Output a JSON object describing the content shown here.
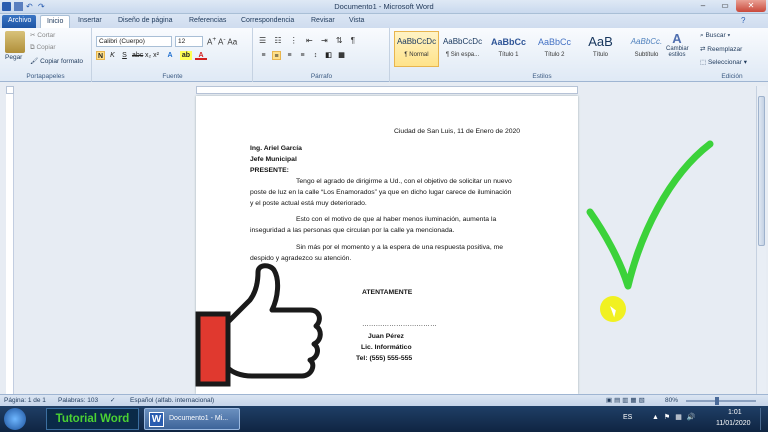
{
  "window": {
    "title": "Documento1 - Microsoft Word"
  },
  "tabs": [
    "Archivo",
    "Inicio",
    "Insertar",
    "Diseño de página",
    "Referencias",
    "Correspondencia",
    "Revisar",
    "Vista"
  ],
  "clipboard": {
    "paste": "Pegar",
    "cut": "Cortar",
    "copy": "Copiar",
    "format_painter": "Copiar formato",
    "group": "Portapapeles"
  },
  "font": {
    "name": "Calibri (Cuerpo)",
    "size": "12",
    "group": "Fuente"
  },
  "paragraph": {
    "group": "Párrafo"
  },
  "styles": {
    "group": "Estilos",
    "change": "Cambiar estilos",
    "items": [
      {
        "preview": "AaBbCcDc",
        "name": "¶ Normal"
      },
      {
        "preview": "AaBbCcDc",
        "name": "¶ Sin espa..."
      },
      {
        "preview": "AaBbCc",
        "name": "Título 1"
      },
      {
        "preview": "AaBbCc",
        "name": "Título 2"
      },
      {
        "preview": "AaB",
        "name": "Título"
      },
      {
        "preview": "AaBbCc.",
        "name": "Subtítulo"
      }
    ]
  },
  "editing": {
    "find": "Buscar",
    "replace": "Reemplazar",
    "select": "Seleccionar",
    "group": "Edición"
  },
  "letter": {
    "date": "Ciudad de San Luis, 11 de Enero de 2020",
    "addressee_name": "Ing. Ariel García",
    "addressee_title": "Jefe Municipal",
    "salutation": "PRESENTE:",
    "p1_l1": "Tengo el agrado de dirigirme a Ud., con el objetivo de solicitar un nuevo",
    "p1_l2": "poste de luz en la calle “Los Enamorados” ya que en dicho lugar carece de iluminación",
    "p1_l3": "y el poste actual está muy deteriorado.",
    "p2_l1": "Esto con el motivo de que al haber menos iluminación, aumenta la",
    "p2_l2": "inseguridad a las personas que circulan por la calle ya mencionada.",
    "p3_l1": "Sin más por el momento y a la espera de una respuesta positiva, me",
    "p3_l2": "despido y agradezco su atención.",
    "closing": "ATENTAMENTE",
    "signature_line": "……………………………",
    "sender_name": "Juan Pérez",
    "sender_title": "Lic. Informático",
    "phone": "Tel: (555) 555-555"
  },
  "status": {
    "page": "Página: 1 de 1",
    "words": "Palabras: 103",
    "language": "Español (alfab. internacional)",
    "zoom": "80%"
  },
  "taskbar": {
    "overlay_label": "Tutorial Word",
    "item": "Documento1 - Mi...",
    "lang": "ES",
    "time": "1:01",
    "date": "11/01/2020"
  },
  "colors": {
    "checkmark": "#3cd23a",
    "cursor_highlight": "#f2f20a",
    "thumb_cuff": "#e0392f"
  }
}
